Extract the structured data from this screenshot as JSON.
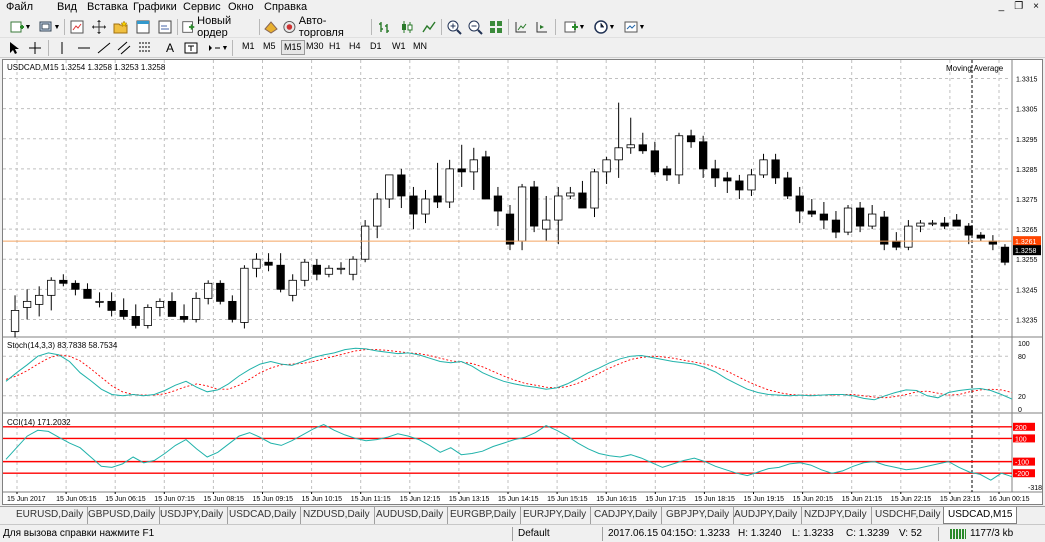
{
  "menu": {
    "items": [
      "Файл",
      "Вид",
      "Вставка",
      "Графики",
      "Сервис",
      "Окно",
      "Справка"
    ],
    "window_controls": [
      "_",
      "❐",
      "×"
    ]
  },
  "toolbar": {
    "new_order_label": "Новый ордер",
    "autotrading_label": "Авто-торговля"
  },
  "timeframes": {
    "items": [
      "M1",
      "M5",
      "M15",
      "M30",
      "H1",
      "H4",
      "D1",
      "W1",
      "MN"
    ],
    "active": "M15"
  },
  "chart": {
    "symbol_info": "USDCAD,M15  1.3254 1.3258 1.3253 1.3258",
    "indicator_label": "Moving Average",
    "price_ticks": [
      "1.3315",
      "1.3305",
      "1.3295",
      "1.3285",
      "1.3275",
      "1.3265",
      "1.3255",
      "1.3245",
      "1.3235"
    ],
    "price_tick_values": [
      1.3315,
      1.3305,
      1.3295,
      1.3285,
      1.3275,
      1.3265,
      1.3255,
      1.3245,
      1.3235
    ],
    "price_range": [
      1.32295,
      1.33185
    ],
    "bid_label": "1.3258",
    "bid_value": 1.3258,
    "line_label": "1.3261",
    "line_value": 1.3261,
    "time_labels": [
      "15 Jun 2017",
      "15 Jun 05:15",
      "15 Jun 06:15",
      "15 Jun 07:15",
      "15 Jun 08:15",
      "15 Jun 09:15",
      "15 Jun 10:15",
      "15 Jun 11:15",
      "15 Jun 12:15",
      "15 Jun 13:15",
      "15 Jun 14:15",
      "15 Jun 15:15",
      "15 Jun 16:15",
      "15 Jun 17:15",
      "15 Jun 18:15",
      "15 Jun 19:15",
      "15 Jun 20:15",
      "15 Jun 21:15",
      "15 Jun 22:15",
      "15 Jun 23:15",
      "16 Jun 00:15"
    ],
    "colors": {
      "bull": "#ffffff",
      "bear": "#000000",
      "line": "#f4a460",
      "bid_bg": "#000000",
      "line_bg": "#ff4500",
      "stoch_main": "#20b2aa",
      "stoch_signal": "#ff0000",
      "cci": "#20b2aa",
      "cci_levels": "#ff0000",
      "grid": "#c0c0c0"
    }
  },
  "stoch": {
    "label": "Stoch(14,3,3) 83.7838 58.7534",
    "levels": [
      "100",
      "80",
      "20",
      "0"
    ],
    "level_values": [
      100,
      80,
      20,
      0
    ]
  },
  "cci": {
    "label": "CCI(14) 171.2032",
    "levels": [
      "200",
      "100",
      "-100",
      "-200"
    ],
    "level_values": [
      200,
      100,
      -100,
      -200
    ],
    "extra_value": "-318.422"
  },
  "chart_data": {
    "type": "candlestick",
    "symbol": "USDCAD",
    "timeframe": "M15",
    "ylim": [
      1.32295,
      1.33185
    ],
    "candles": [
      [
        1.3231,
        1.3243,
        1.3229,
        1.3238
      ],
      [
        1.3239,
        1.3245,
        1.3235,
        1.3241
      ],
      [
        1.324,
        1.3246,
        1.3236,
        1.3243
      ],
      [
        1.3243,
        1.3249,
        1.3238,
        1.3248
      ],
      [
        1.3248,
        1.325,
        1.3246,
        1.3247
      ],
      [
        1.3247,
        1.3248,
        1.3243,
        1.3245
      ],
      [
        1.3245,
        1.3247,
        1.3243,
        1.3242
      ],
      [
        1.3241,
        1.3244,
        1.3239,
        1.3241
      ],
      [
        1.3241,
        1.3244,
        1.3236,
        1.3238
      ],
      [
        1.3238,
        1.3242,
        1.3235,
        1.3236
      ],
      [
        1.3236,
        1.324,
        1.3232,
        1.3233
      ],
      [
        1.3233,
        1.324,
        1.3232,
        1.3239
      ],
      [
        1.3239,
        1.3242,
        1.3236,
        1.3241
      ],
      [
        1.3241,
        1.3244,
        1.3239,
        1.3236
      ],
      [
        1.3236,
        1.324,
        1.3234,
        1.3235
      ],
      [
        1.3235,
        1.3244,
        1.3234,
        1.3242
      ],
      [
        1.3242,
        1.3248,
        1.324,
        1.3247
      ],
      [
        1.3247,
        1.3248,
        1.324,
        1.3241
      ],
      [
        1.3241,
        1.3243,
        1.3234,
        1.3235
      ],
      [
        1.3234,
        1.3253,
        1.3232,
        1.3252
      ],
      [
        1.3252,
        1.3257,
        1.3249,
        1.3255
      ],
      [
        1.3254,
        1.3257,
        1.3251,
        1.3253
      ],
      [
        1.3253,
        1.3257,
        1.3244,
        1.3245
      ],
      [
        1.3243,
        1.325,
        1.3241,
        1.3248
      ],
      [
        1.3248,
        1.3255,
        1.3246,
        1.3254
      ],
      [
        1.3253,
        1.3255,
        1.3248,
        1.325
      ],
      [
        1.325,
        1.3253,
        1.3249,
        1.3252
      ],
      [
        1.3252,
        1.3254,
        1.325,
        1.3252
      ],
      [
        1.325,
        1.3256,
        1.3248,
        1.3255
      ],
      [
        1.3255,
        1.3268,
        1.3254,
        1.3266
      ],
      [
        1.3266,
        1.3277,
        1.3262,
        1.3275
      ],
      [
        1.3275,
        1.3282,
        1.3272,
        1.3283
      ],
      [
        1.3283,
        1.3285,
        1.3272,
        1.3276
      ],
      [
        1.3276,
        1.3279,
        1.3265,
        1.327
      ],
      [
        1.327,
        1.3278,
        1.3267,
        1.3275
      ],
      [
        1.3276,
        1.3287,
        1.3272,
        1.3274
      ],
      [
        1.3274,
        1.3288,
        1.3272,
        1.3285
      ],
      [
        1.3285,
        1.3293,
        1.3279,
        1.3284
      ],
      [
        1.3284,
        1.3292,
        1.3278,
        1.3288
      ],
      [
        1.3289,
        1.3291,
        1.3275,
        1.3275
      ],
      [
        1.3276,
        1.3279,
        1.3266,
        1.3271
      ],
      [
        1.327,
        1.3273,
        1.3258,
        1.326
      ],
      [
        1.3261,
        1.328,
        1.3258,
        1.3279
      ],
      [
        1.3279,
        1.3281,
        1.3264,
        1.3266
      ],
      [
        1.3265,
        1.3276,
        1.3261,
        1.3268
      ],
      [
        1.3268,
        1.3279,
        1.326,
        1.3276
      ],
      [
        1.3276,
        1.3279,
        1.3275,
        1.3277
      ],
      [
        1.3277,
        1.3281,
        1.3274,
        1.3272
      ],
      [
        1.3272,
        1.3285,
        1.3269,
        1.3284
      ],
      [
        1.3284,
        1.3289,
        1.328,
        1.3288
      ],
      [
        1.3288,
        1.3307,
        1.3282,
        1.3292
      ],
      [
        1.3292,
        1.3302,
        1.329,
        1.3293
      ],
      [
        1.3293,
        1.3297,
        1.329,
        1.3291
      ],
      [
        1.3291,
        1.3294,
        1.3283,
        1.3284
      ],
      [
        1.3285,
        1.3286,
        1.3281,
        1.3283
      ],
      [
        1.3283,
        1.3297,
        1.328,
        1.3296
      ],
      [
        1.3296,
        1.3298,
        1.3292,
        1.3294
      ],
      [
        1.3294,
        1.3296,
        1.3282,
        1.3285
      ],
      [
        1.3285,
        1.3288,
        1.3279,
        1.3282
      ],
      [
        1.3282,
        1.3284,
        1.3277,
        1.3281
      ],
      [
        1.3281,
        1.3283,
        1.3275,
        1.3278
      ],
      [
        1.3278,
        1.3285,
        1.3276,
        1.3283
      ],
      [
        1.3283,
        1.329,
        1.3282,
        1.3288
      ],
      [
        1.3288,
        1.329,
        1.328,
        1.3282
      ],
      [
        1.3282,
        1.3284,
        1.3275,
        1.3276
      ],
      [
        1.3276,
        1.3279,
        1.3267,
        1.3271
      ],
      [
        1.3271,
        1.3275,
        1.3269,
        1.327
      ],
      [
        1.327,
        1.3274,
        1.3265,
        1.3268
      ],
      [
        1.3268,
        1.3271,
        1.3262,
        1.3264
      ],
      [
        1.3264,
        1.3273,
        1.3263,
        1.3272
      ],
      [
        1.3272,
        1.3274,
        1.3264,
        1.3266
      ],
      [
        1.3266,
        1.3273,
        1.3265,
        1.327
      ],
      [
        1.3269,
        1.3271,
        1.3258,
        1.326
      ],
      [
        1.3261,
        1.3264,
        1.3258,
        1.3259
      ],
      [
        1.3259,
        1.3268,
        1.3258,
        1.3266
      ],
      [
        1.3266,
        1.3268,
        1.3264,
        1.3267
      ],
      [
        1.3267,
        1.3268,
        1.3266,
        1.3267
      ],
      [
        1.3267,
        1.3269,
        1.3265,
        1.3266
      ],
      [
        1.3268,
        1.327,
        1.3266,
        1.3266
      ],
      [
        1.3266,
        1.3267,
        1.326,
        1.3263
      ],
      [
        1.3263,
        1.3264,
        1.3261,
        1.3262
      ],
      [
        1.3261,
        1.3263,
        1.3258,
        1.326
      ],
      [
        1.3259,
        1.326,
        1.3253,
        1.3254
      ]
    ],
    "stoch_main": [
      42,
      55,
      67,
      80,
      85,
      82,
      72,
      55,
      43,
      30,
      22,
      20,
      22,
      20,
      22,
      28,
      36,
      42,
      33,
      26,
      29,
      38,
      50,
      60,
      68,
      72,
      68,
      66,
      72,
      78,
      82,
      85,
      90,
      92,
      91,
      88,
      86,
      84,
      85,
      82,
      77,
      72,
      70,
      72,
      65,
      55,
      48,
      42,
      38,
      35,
      33,
      30,
      32,
      38,
      46,
      55,
      62,
      70,
      76,
      80,
      81,
      78,
      75,
      72,
      70,
      68,
      63,
      56,
      46,
      38,
      30,
      25,
      22,
      21,
      20,
      21,
      20,
      21,
      22,
      22,
      20,
      16,
      14,
      20,
      25,
      29,
      28,
      20,
      17,
      25,
      28,
      30,
      31,
      28,
      22,
      15
    ],
    "stoch_signal": [
      45,
      50,
      58,
      68,
      77,
      82,
      80,
      73,
      61,
      48,
      35,
      26,
      22,
      21,
      21,
      23,
      28,
      34,
      38,
      35,
      30,
      30,
      36,
      45,
      55,
      62,
      67,
      68,
      69,
      72,
      76,
      80,
      84,
      88,
      90,
      90,
      89,
      87,
      85,
      84,
      81,
      77,
      73,
      71,
      69,
      64,
      57,
      50,
      44,
      39,
      36,
      33,
      32,
      34,
      39,
      46,
      54,
      62,
      69,
      75,
      78,
      80,
      79,
      77,
      74,
      71,
      68,
      64,
      58,
      50,
      42,
      35,
      29,
      25,
      22,
      21,
      21,
      21,
      21,
      22,
      22,
      20,
      18,
      17,
      19,
      22,
      26,
      27,
      24,
      21,
      22,
      26,
      29,
      30,
      29,
      25
    ]
  }
}
